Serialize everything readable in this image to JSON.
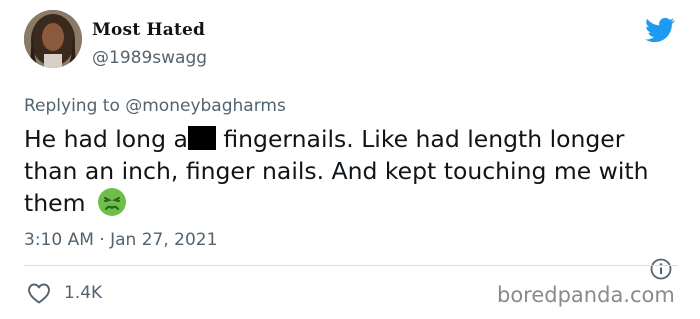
{
  "user": {
    "display_name": "Most Hated",
    "handle": "@1989swagg"
  },
  "reply": {
    "prefix": "Replying to",
    "mention": "@moneybagharms"
  },
  "tweet": {
    "text_start": "He had long a",
    "text_rest": " fingernails. Like had length longer than an inch, finger nails. And kept touching me with them",
    "emoji": "nauseated-face",
    "time": "3:10 AM",
    "separator": "·",
    "date": "Jan 27, 2021",
    "like_count": "1.4K"
  },
  "icons": {
    "brand": "twitter-bird-icon",
    "info": "info-icon",
    "like": "heart-icon"
  },
  "colors": {
    "twitter_blue": "#1d9bf0",
    "secondary_text": "#536471",
    "emoji_green": "#6dbf4a"
  },
  "watermark": "boredpanda.com"
}
